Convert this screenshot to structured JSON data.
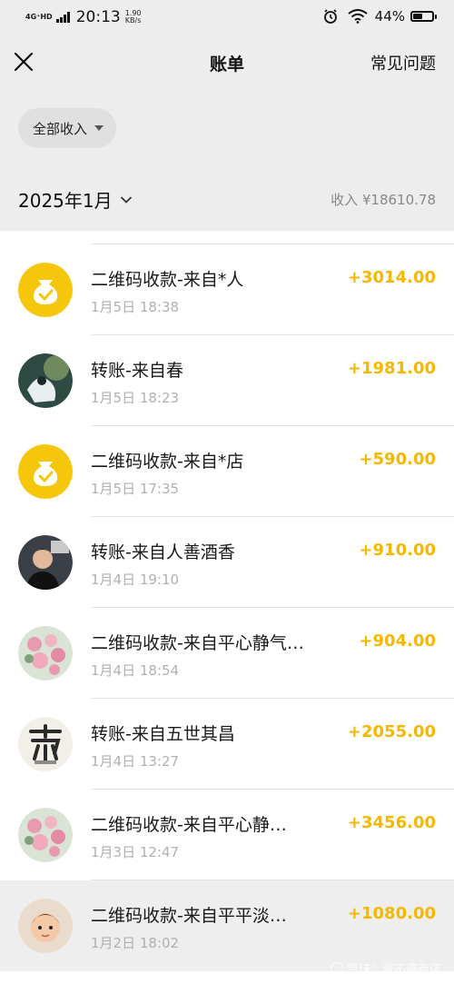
{
  "status_bar": {
    "network": "4G⁺HD",
    "time": "20:13",
    "speed_value": "1.90",
    "speed_unit": "KB/s",
    "battery": "44%"
  },
  "nav": {
    "title": "账单",
    "faq_label": "常见问题"
  },
  "filter": {
    "label": "全部收入"
  },
  "summary": {
    "month": "2025年1月",
    "income": "收入 ¥18610.78"
  },
  "colors": {
    "accent": "#f5b800",
    "background": "#ededed"
  },
  "transactions": [
    {
      "title": "二维码收款-来自*人",
      "date": "1月5日 18:38",
      "amount": "+3014.00",
      "avatar": "money-bag-icon"
    },
    {
      "title": "转账-来自春",
      "date": "1月5日 18:23",
      "amount": "+1981.00",
      "avatar": "photo-avatar"
    },
    {
      "title": "二维码收款-来自*店",
      "date": "1月5日 17:35",
      "amount": "+590.00",
      "avatar": "money-bag-icon"
    },
    {
      "title": "转账-来自人善酒香",
      "date": "1月4日 19:10",
      "amount": "+910.00",
      "avatar": "photo-avatar"
    },
    {
      "title": "二维码收款-来自平心静气…",
      "date": "1月4日 18:54",
      "amount": "+904.00",
      "avatar": "flowers-avatar"
    },
    {
      "title": "转账-来自五世其昌",
      "date": "1月4日 13:27",
      "amount": "+2055.00",
      "avatar": "photo-avatar"
    },
    {
      "title": "二维码收款-来自平心静…",
      "date": "1月3日 12:47",
      "amount": "+3456.00",
      "avatar": "flowers-avatar"
    },
    {
      "title": "二维码收款-来自平平淡…",
      "date": "1月2日 18:02",
      "amount": "+1080.00",
      "avatar": "photo-avatar"
    }
  ],
  "watermark": "雪球：涨不停商店"
}
